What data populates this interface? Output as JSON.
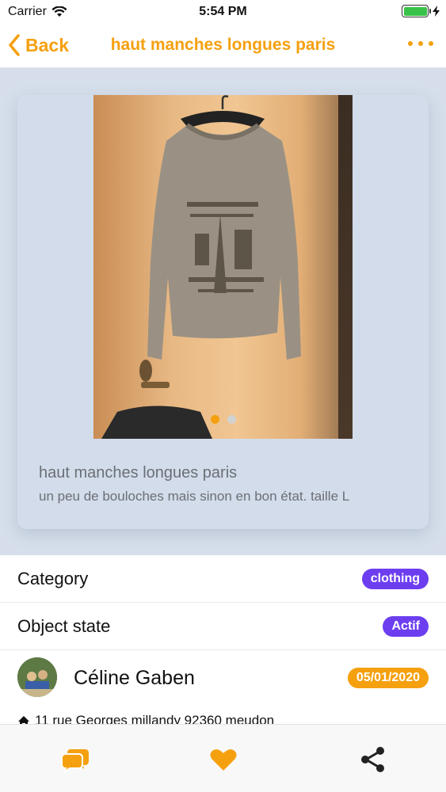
{
  "status_bar": {
    "carrier": "Carrier",
    "time": "5:54 PM",
    "battery_level": 1.0,
    "battery_color": "#39c24a"
  },
  "nav": {
    "back_label": "Back",
    "title": "haut manches longues paris",
    "accent_color": "#f5a00f"
  },
  "item": {
    "title": "haut manches longues paris",
    "description": "un peu de bouloches mais sinon en bon état. taille L",
    "photo_count": 2,
    "active_photo_index": 0
  },
  "details": {
    "category_label": "Category",
    "category_value": "clothing",
    "state_label": "Object state",
    "state_value": "Actif"
  },
  "owner": {
    "name": "Céline Gaben",
    "date": "05/01/2020"
  },
  "address": {
    "icon": "home-icon",
    "text": "11 rue Georges millandy 92360 meudon"
  },
  "tabs": [
    {
      "icon": "chat-bubbles-icon"
    },
    {
      "icon": "heart-icon"
    },
    {
      "icon": "share-icon"
    }
  ]
}
